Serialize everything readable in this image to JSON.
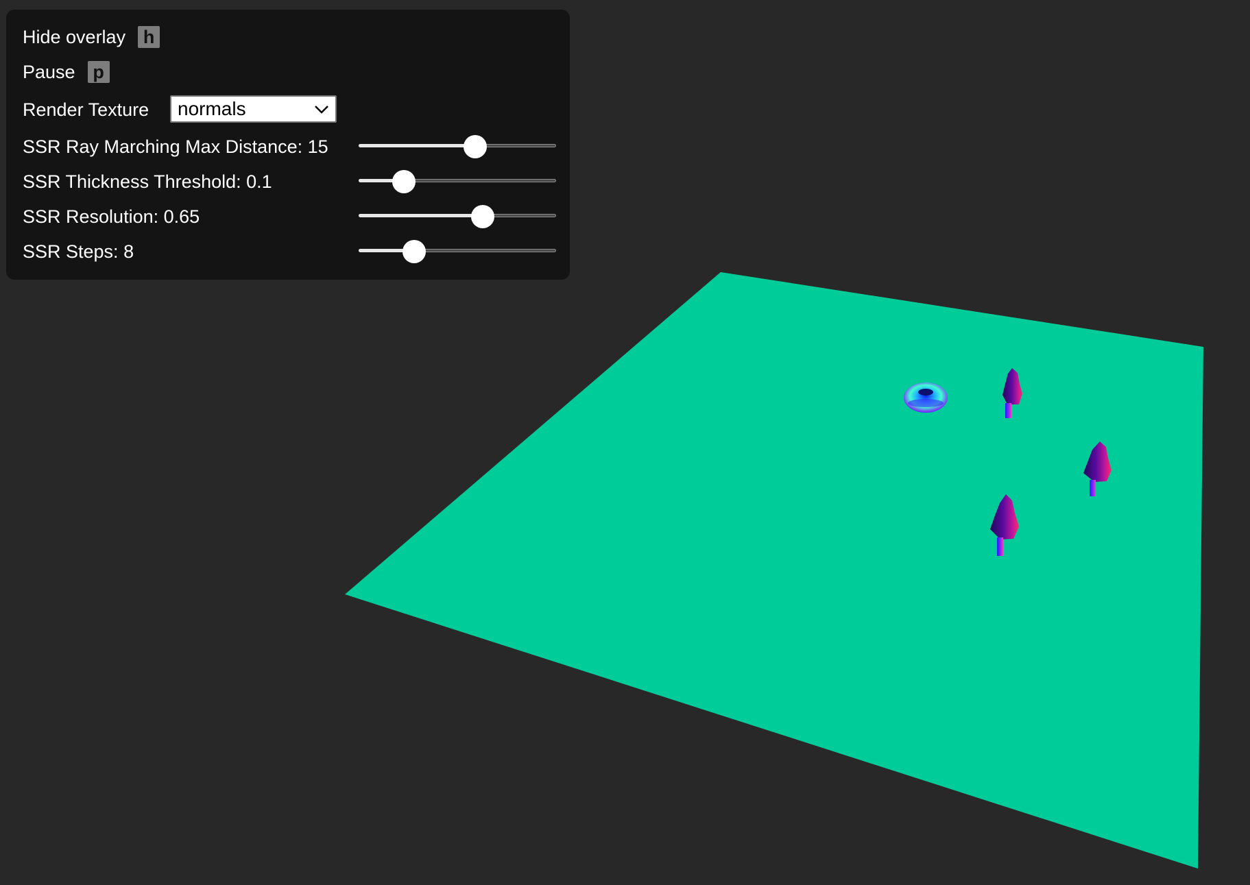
{
  "overlay": {
    "hide_label": "Hide overlay",
    "hide_key": "h",
    "pause_label": "Pause",
    "pause_key": "p",
    "render_texture_label": "Render Texture",
    "render_texture_value": "normals",
    "sliders": [
      {
        "label": "SSR Ray Marching Max Distance: 15",
        "value": 15,
        "fraction": 0.59
      },
      {
        "label": "SSR Thickness Threshold: 0.1",
        "value": 0.1,
        "fraction": 0.23
      },
      {
        "label": "SSR Resolution: 0.65",
        "value": 0.65,
        "fraction": 0.63
      },
      {
        "label": "SSR Steps: 8",
        "value": 8,
        "fraction": 0.28
      }
    ]
  },
  "colors": {
    "background": "#282828",
    "overlay_bg": "#141414",
    "ground_plane": "#00cc99"
  }
}
